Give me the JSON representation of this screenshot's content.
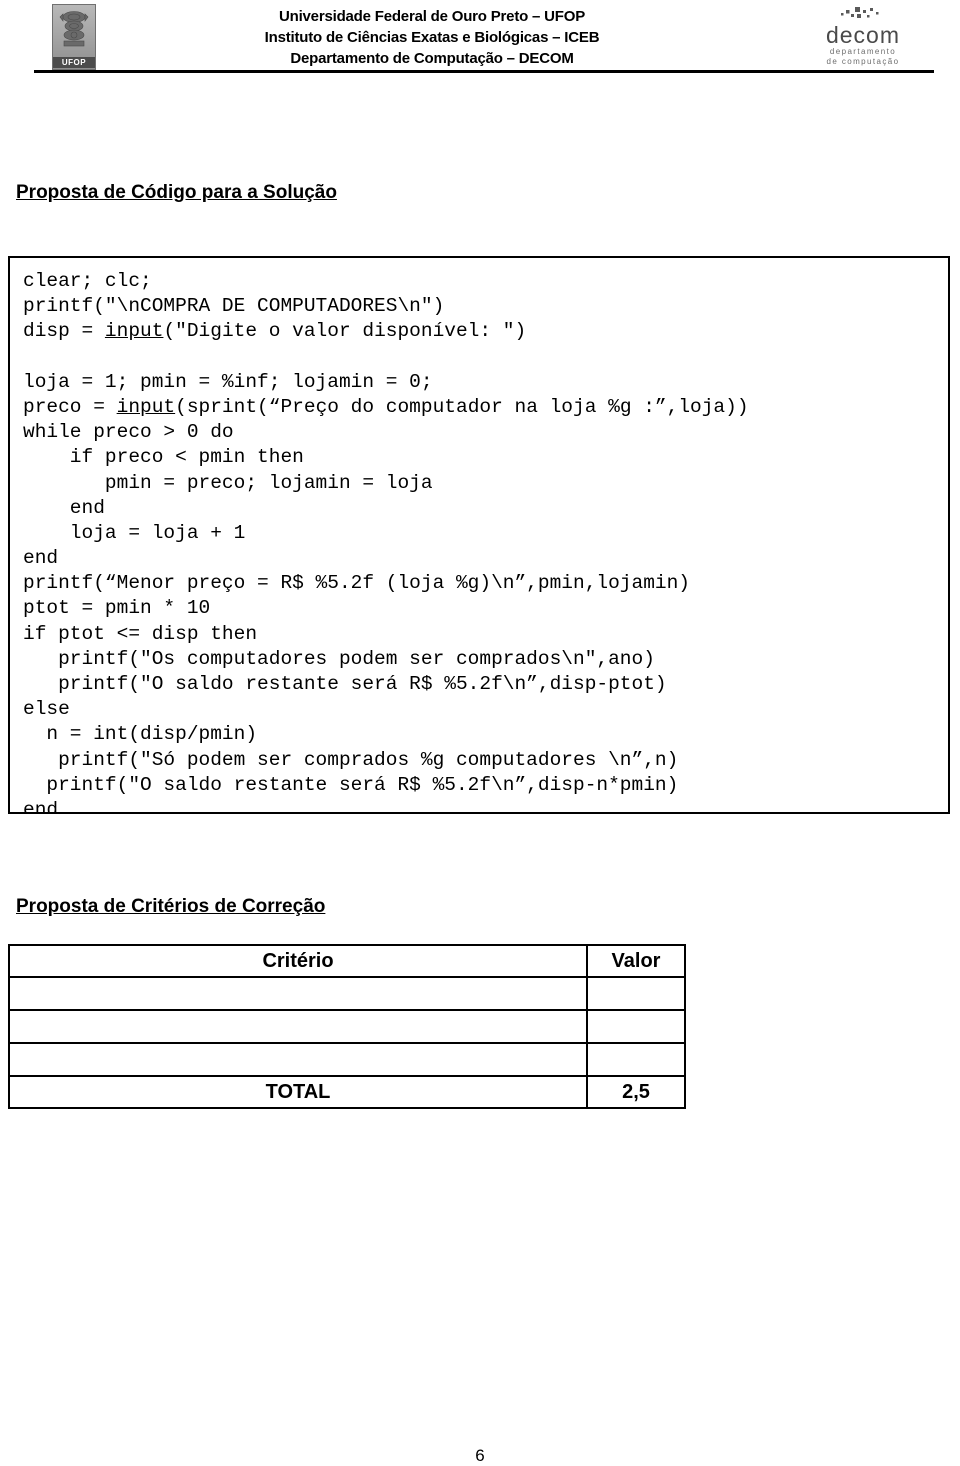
{
  "header": {
    "institution_line1": "Universidade Federal de Ouro Preto – UFOP",
    "institution_line2": "Instituto de Ciências Exatas e Biológicas – ICEB",
    "institution_line3": "Departamento de Computação – DECOM",
    "ufop_logo_label": "UFOP",
    "decom_logo_word": "decom",
    "decom_logo_sub_line1": "departamento",
    "decom_logo_sub_line2": "de computação"
  },
  "sections": {
    "code_title": "Proposta de Código para a Solução",
    "criteria_title": "Proposta de Critérios de Correção"
  },
  "code": {
    "lines": [
      "clear; clc;",
      "printf(\"\\nCOMPRA DE COMPUTADORES\\n\")",
      "disp = input(\"Digite o valor disponível: \")",
      "",
      "loja = 1; pmin = %inf; lojamin = 0;",
      "preco = input(sprint(“Preço do computador na loja %g :”,loja))",
      "while preco > 0 do",
      "    if preco < pmin then",
      "       pmin = preco; lojamin = loja",
      "    end",
      "    loja = loja + 1",
      "end",
      "printf(“Menor preço = R$ %5.2f (loja %g)\\n”,pmin,lojamin)",
      "ptot = pmin * 10",
      "if ptot <= disp then",
      "   printf(\"Os computadores podem ser comprados\\n\",ano)",
      "   printf(\"O saldo restante será R$ %5.2f\\n”,disp-ptot)",
      "else",
      "  n = int(disp/pmin)",
      "   printf(\"Só podem ser comprados %g computadores \\n”,n)",
      "  printf(\"O saldo restante será R$ %5.2f\\n”,disp-n*pmin)",
      "end"
    ],
    "underlined_tokens": [
      "input"
    ]
  },
  "criteria_table": {
    "headers": [
      "Critério",
      "Valor"
    ],
    "rows": [
      {
        "criterio": "",
        "valor": ""
      },
      {
        "criterio": "",
        "valor": ""
      },
      {
        "criterio": "",
        "valor": ""
      }
    ],
    "total_label": "TOTAL",
    "total_value": "2,5"
  },
  "footer": {
    "page_number": "6"
  }
}
